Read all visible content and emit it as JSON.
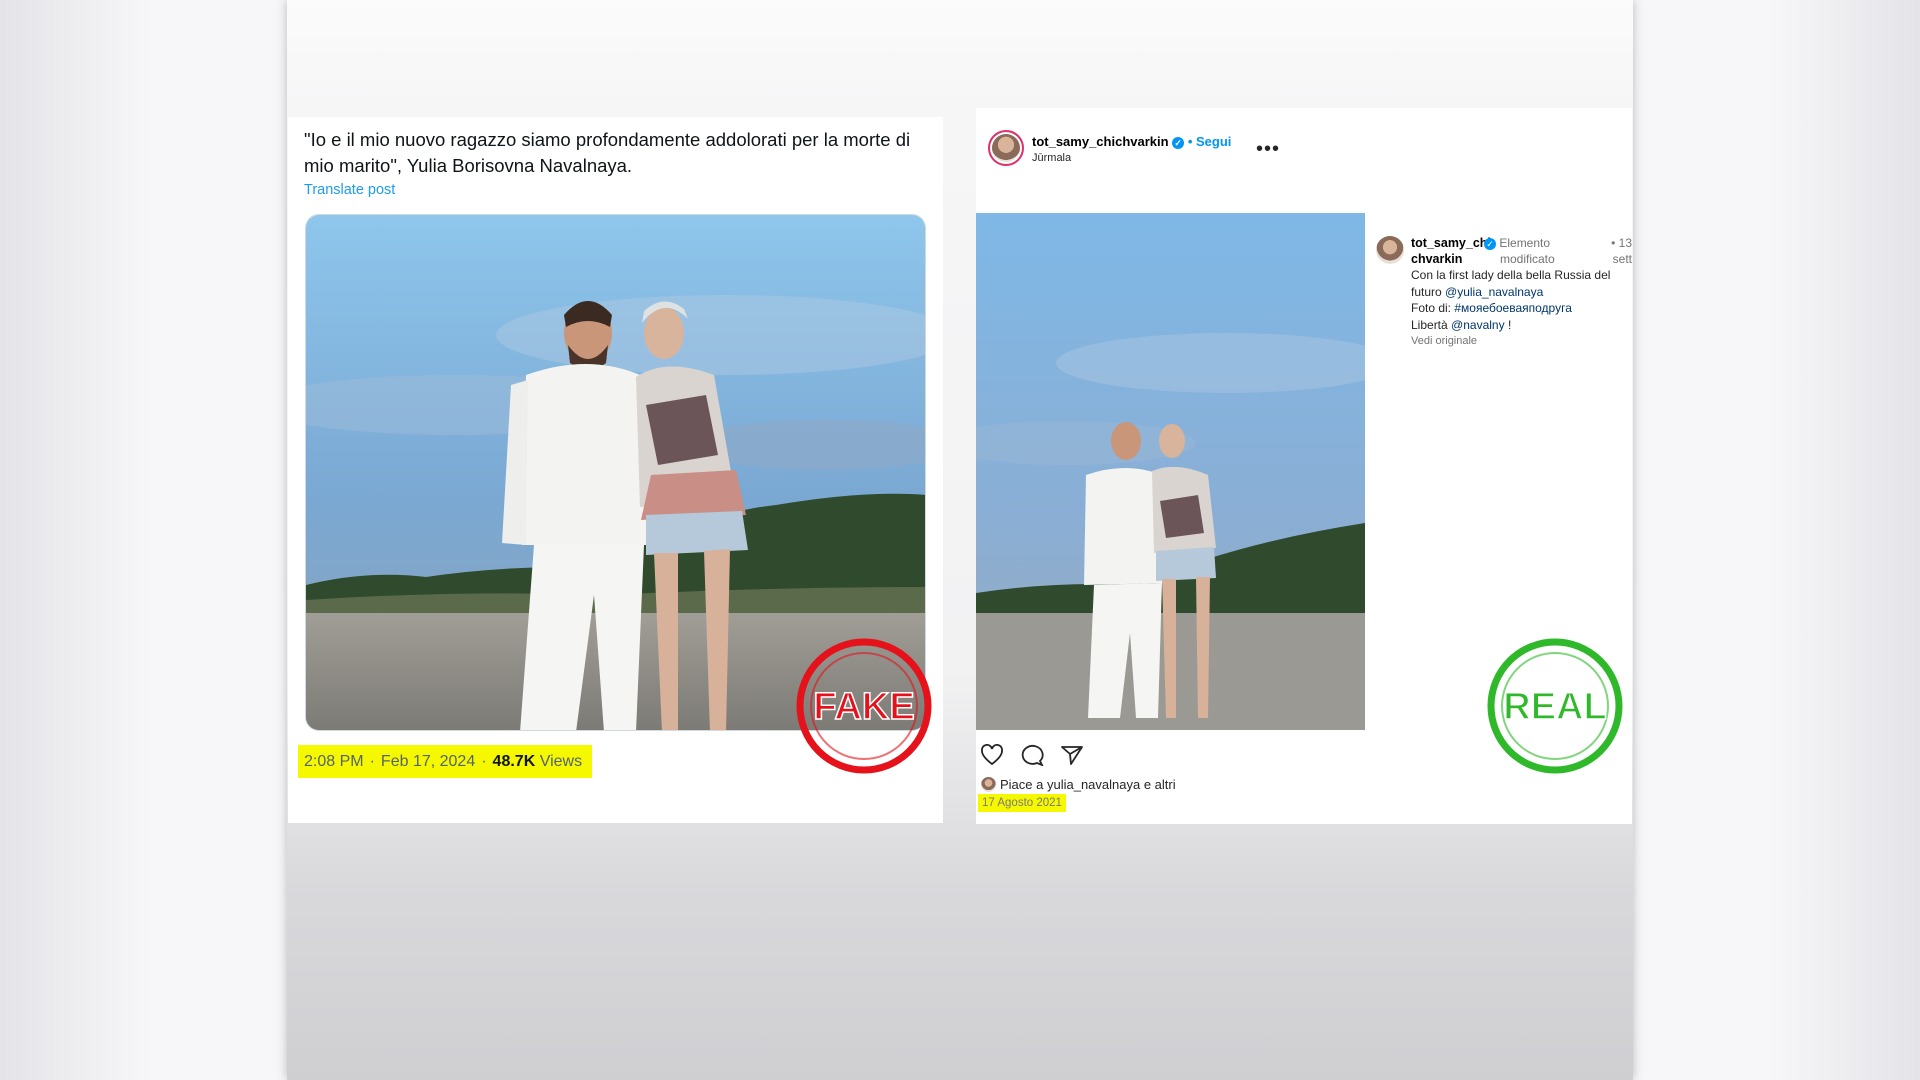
{
  "tweet": {
    "text": "\"Io e il mio nuovo ragazzo siamo profondamente addolorati per la morte di mio marito\", Yulia Borisovna Navalnaya.",
    "translate_label": "Translate post",
    "time": "2:08 PM",
    "date": "Feb 17, 2024",
    "views_count": "48.7K",
    "views_label": "Views",
    "separator": "·"
  },
  "instagram": {
    "username": "tot_samy_chichvarkin",
    "verified_symbol": "✓",
    "follow_label": "Segui",
    "location": "Jūrmala",
    "more_icon": "•••",
    "caption_user_line1": "tot_samy_chi",
    "caption_user_line2": "chvarkin",
    "edited_line1": "Elemento",
    "edited_line2": "modificato",
    "time_line1": "13",
    "time_line2": "sett",
    "caption_text": "Con la first lady della bella Russia del futuro",
    "mention_1": "@yulia_navalnaya",
    "photo_credit_label": "Foto di:",
    "hashtag": "#мояебоеваяподруга",
    "liberta_label": "Libertà",
    "mention_2": "@navalny",
    "exclamation": "!",
    "see_original": "Vedi originale",
    "likes_text": "Piace a yulia_navalnaya e altri",
    "date": "17 Agosto 2021"
  },
  "stamps": {
    "fake_label": "FAKE",
    "fake_color": "#e5121b",
    "real_label": "REAL",
    "real_color": "#2fb92a"
  },
  "colors": {
    "highlight": "#f6f800",
    "twitter_blue": "#1d9bf0",
    "instagram_blue": "#0095f6"
  }
}
